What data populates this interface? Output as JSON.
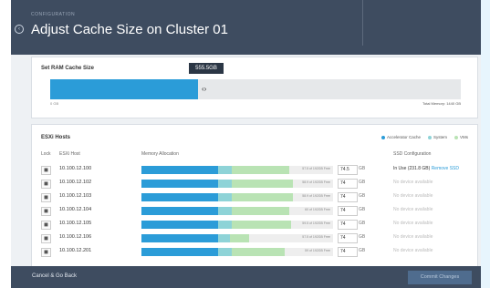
{
  "header": {
    "eyebrow": "CONFIGURATION",
    "title": "Adjust Cache Size on Cluster 01"
  },
  "ram": {
    "title": "Set RAM Cache Size",
    "tooltip": "555.5",
    "tooltip_unit": "GB",
    "fill_fraction": 0.36,
    "min_label": "0 GB",
    "total_label": "Total Memory: 1440 GB"
  },
  "hosts": {
    "title": "ESXi Hosts",
    "legend": [
      {
        "label": "Accelerator Cache",
        "color": "#2b9cd8"
      },
      {
        "label": "System",
        "color": "#8ed3d7"
      },
      {
        "label": "VMs",
        "color": "#b9e3b4"
      }
    ],
    "columns": {
      "lock": "Lock",
      "host": "ESXi Host",
      "memory": "Memory Allocation",
      "ssd": "SSD Configuration"
    },
    "rows": [
      {
        "host": "10.100.12.100",
        "cache": 0.4,
        "system": 0.07,
        "vms": 0.3,
        "value": "74.5",
        "unit": "GB",
        "bar_label": "57.5 of 192GB Free",
        "ssd": "In Use (231.8 GB)",
        "ssd_action": "Remove SSD"
      },
      {
        "host": "10.100.12.102",
        "cache": 0.4,
        "system": 0.07,
        "vms": 0.32,
        "value": "74",
        "unit": "GB",
        "bar_label": "58.9 of 192GB Free",
        "ssd": "No device available",
        "ssd_action": ""
      },
      {
        "host": "10.100.12.103",
        "cache": 0.4,
        "system": 0.07,
        "vms": 0.32,
        "value": "74",
        "unit": "GB",
        "bar_label": "58.9 of 192GB Free",
        "ssd": "No device available",
        "ssd_action": ""
      },
      {
        "host": "10.100.12.104",
        "cache": 0.4,
        "system": 0.07,
        "vms": 0.3,
        "value": "74",
        "unit": "GB",
        "bar_label": "60 of 192GB Free",
        "ssd": "No device available",
        "ssd_action": ""
      },
      {
        "host": "10.100.12.105",
        "cache": 0.4,
        "system": 0.07,
        "vms": 0.31,
        "value": "74",
        "unit": "GB",
        "bar_label": "59.5 of 192GB Free",
        "ssd": "No device available",
        "ssd_action": ""
      },
      {
        "host": "10.100.12.106",
        "cache": 0.4,
        "system": 0.06,
        "vms": 0.1,
        "value": "74",
        "unit": "GB",
        "bar_label": "57.5 of 192GB Free",
        "ssd": "No device available",
        "ssd_action": ""
      },
      {
        "host": "10.100.12.201",
        "cache": 0.4,
        "system": 0.07,
        "vms": 0.28,
        "value": "74",
        "unit": "GB",
        "bar_label": "59 of 192GB Free",
        "ssd": "No device available",
        "ssd_action": ""
      }
    ]
  },
  "footer": {
    "cancel": "Cancel & Go Back",
    "commit": "Commit Changes"
  }
}
